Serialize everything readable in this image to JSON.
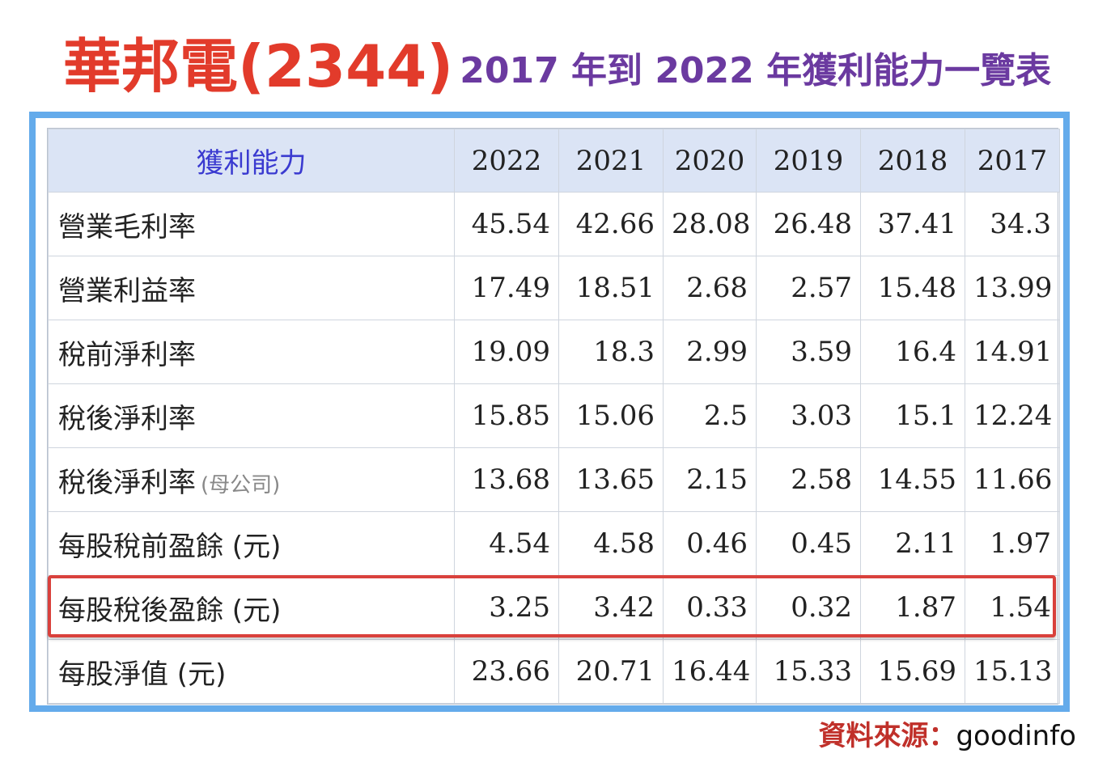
{
  "title": {
    "main": "華邦電(2344)",
    "sub": "2017 年到 2022 年獲利能力一覽表"
  },
  "table": {
    "header_label": "獲利能力",
    "years": [
      "2022",
      "2021",
      "2020",
      "2019",
      "2018",
      "2017"
    ],
    "rows": [
      {
        "label": "營業毛利率",
        "note": "",
        "values": [
          "45.54",
          "42.66",
          "28.08",
          "26.48",
          "37.41",
          "34.3"
        ]
      },
      {
        "label": "營業利益率",
        "note": "",
        "values": [
          "17.49",
          "18.51",
          "2.68",
          "2.57",
          "15.48",
          "13.99"
        ]
      },
      {
        "label": "稅前淨利率",
        "note": "",
        "values": [
          "19.09",
          "18.3",
          "2.99",
          "3.59",
          "16.4",
          "14.91"
        ]
      },
      {
        "label": "稅後淨利率",
        "note": "",
        "values": [
          "15.85",
          "15.06",
          "2.5",
          "3.03",
          "15.1",
          "12.24"
        ]
      },
      {
        "label": "稅後淨利率",
        "note": "(母公司)",
        "values": [
          "13.68",
          "13.65",
          "2.15",
          "2.58",
          "14.55",
          "11.66"
        ]
      },
      {
        "label": "每股稅前盈餘 (元)",
        "note": "",
        "values": [
          "4.54",
          "4.58",
          "0.46",
          "0.45",
          "2.11",
          "1.97"
        ]
      },
      {
        "label": "每股稅後盈餘 (元)",
        "note": "",
        "values": [
          "3.25",
          "3.42",
          "0.33",
          "0.32",
          "1.87",
          "1.54"
        ]
      },
      {
        "label": "每股淨值 (元)",
        "note": "",
        "values": [
          "23.66",
          "20.71",
          "16.44",
          "15.33",
          "15.69",
          "15.13"
        ]
      }
    ],
    "highlighted_row": 6
  },
  "source": {
    "label": "資料來源：",
    "value": "goodinfo"
  },
  "colors": {
    "title_main": "#e23b2b",
    "title_sub": "#6b3aa0",
    "frame": "#64abeb",
    "header_bg": "#dbe4f5",
    "header_label": "#3a3ad0",
    "highlight": "#d9413c",
    "source_label": "#c0302a"
  }
}
